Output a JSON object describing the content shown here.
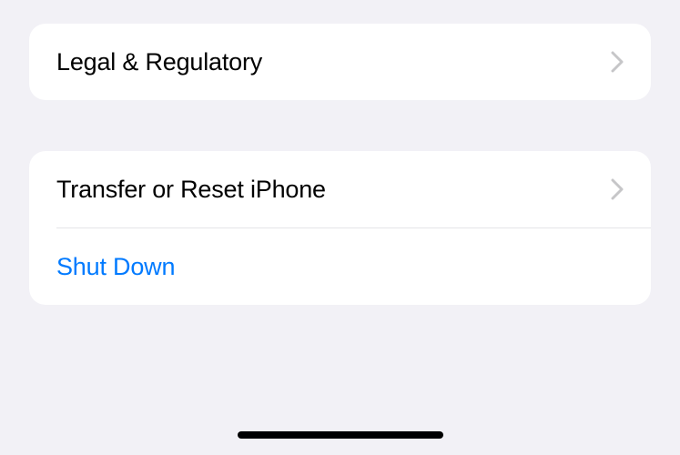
{
  "groups": [
    {
      "items": [
        {
          "label": "Legal & Regulatory",
          "has_chevron": true,
          "accent": false
        }
      ]
    },
    {
      "items": [
        {
          "label": "Transfer or Reset iPhone",
          "has_chevron": true,
          "accent": false
        },
        {
          "label": "Shut Down",
          "has_chevron": false,
          "accent": true
        }
      ]
    }
  ]
}
